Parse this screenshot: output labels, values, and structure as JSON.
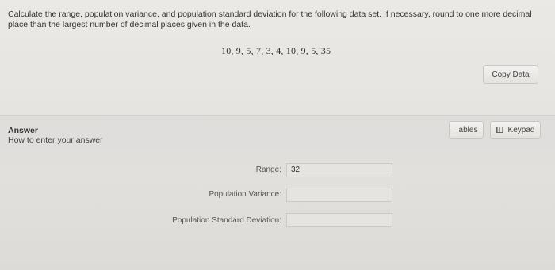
{
  "question": {
    "text": "Calculate the range, population variance, and population standard deviation for the following data set. If necessary, round to one more decimal place than the largest number of decimal places given in the data.",
    "data_set": "10, 9, 5, 7, 3, 4, 10, 9, 5, 35",
    "copy_label": "Copy Data"
  },
  "answer": {
    "title": "Answer",
    "howto": "How to enter your answer",
    "tables_label": "Tables",
    "keypad_label": "Keypad",
    "fields": [
      {
        "label": "Range:",
        "value": "32"
      },
      {
        "label": "Population Variance:",
        "value": ""
      },
      {
        "label": "Population Standard Deviation:",
        "value": ""
      }
    ]
  },
  "icons": {
    "keypad": "keypad-icon"
  }
}
